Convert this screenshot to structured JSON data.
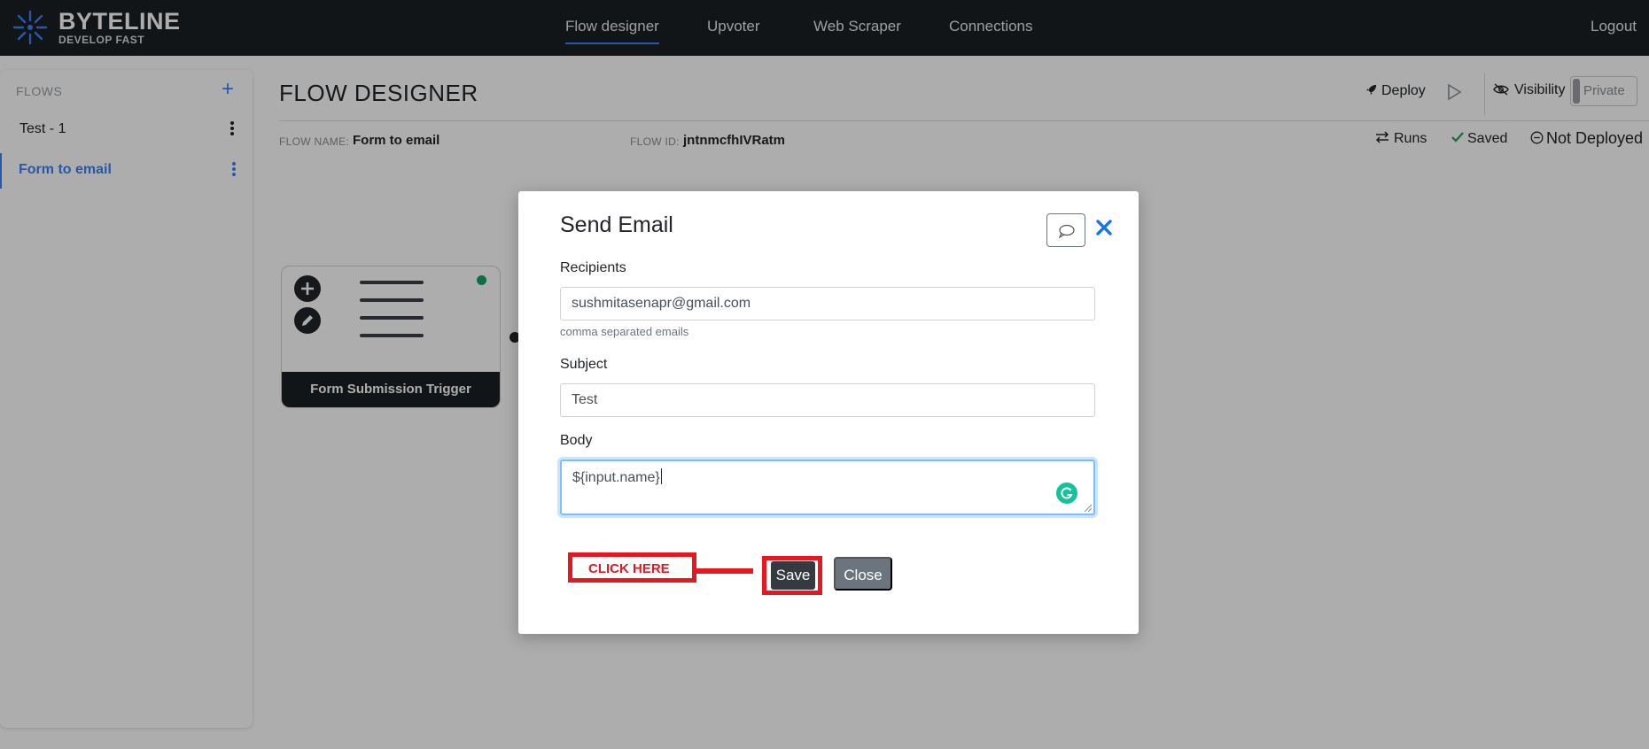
{
  "app": {
    "brand": "BYTELINE",
    "tagline": "DEVELOP FAST"
  },
  "nav": {
    "items": [
      {
        "label": "Flow designer",
        "active": true
      },
      {
        "label": "Upvoter"
      },
      {
        "label": "Web Scraper"
      },
      {
        "label": "Connections"
      }
    ],
    "logout": "Logout"
  },
  "sidebar": {
    "heading": "FLOWS",
    "items": [
      {
        "label": "Test - 1"
      },
      {
        "label": "Form to email",
        "active": true
      }
    ]
  },
  "header": {
    "title": "FLOW DESIGNER",
    "flow_name_label": "FLOW NAME:",
    "flow_name": "Form to email",
    "flow_id_label": "FLOW ID:",
    "flow_id": "jntnmcfhIVRatm",
    "deploy": "Deploy",
    "visibility": "Visibility",
    "private": "Private",
    "runs": "Runs",
    "saved": "Saved",
    "not_deployed": "Not Deployed"
  },
  "canvas": {
    "node_title": "Form Submission Trigger"
  },
  "modal": {
    "title": "Send Email",
    "recipients_label": "Recipients",
    "recipients_value": "sushmitasenapr@gmail.com",
    "recipients_help": "comma separated emails",
    "subject_label": "Subject",
    "subject_value": "Test",
    "body_label": "Body",
    "body_value": "${input.name}",
    "annotation": "CLICK HERE",
    "save": "Save",
    "close": "Close"
  },
  "colors": {
    "accent": "#3b82f6",
    "annotation_red": "#e8161e",
    "saved_green": "#1aa260",
    "topbar": "#1b1f23"
  }
}
